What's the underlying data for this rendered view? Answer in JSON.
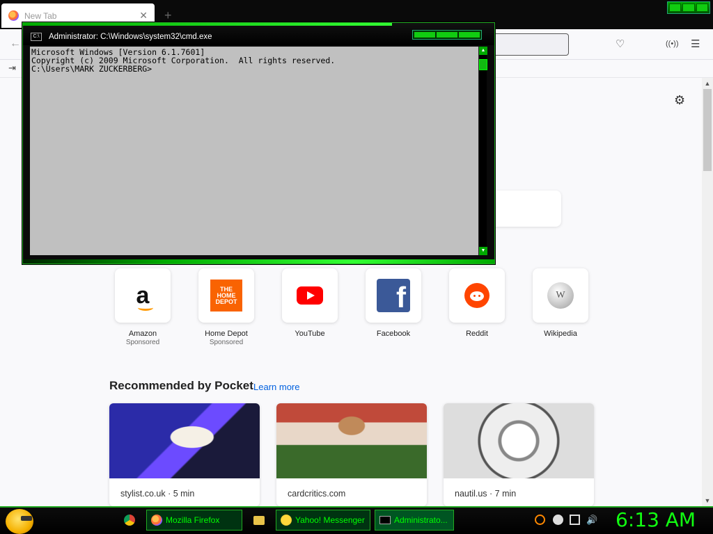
{
  "browser": {
    "tab_title": "New Tab",
    "tab_close": "✕",
    "new_tab": "+",
    "back": "←",
    "toolbar_icons": [
      "pocket-icon",
      "account-icon",
      "extensions-icon",
      "menu-icon"
    ],
    "bookmarks_icon": "sign-in-icon"
  },
  "newtab": {
    "settings_icon": "⚙",
    "top_sites": [
      {
        "name": "Amazon",
        "sponsored": "Sponsored",
        "logo": "a"
      },
      {
        "name": "Home Depot",
        "sponsored": "Sponsored",
        "logo": "THE HOME DEPOT"
      },
      {
        "name": "YouTube",
        "sponsored": ""
      },
      {
        "name": "Facebook",
        "sponsored": "",
        "logo": "f"
      },
      {
        "name": "Reddit",
        "sponsored": ""
      },
      {
        "name": "Wikipedia",
        "sponsored": "",
        "logo": "W"
      }
    ],
    "pocket_title": "Recommended by Pocket",
    "pocket_learn": "Learn more",
    "cards": [
      {
        "source": "stylist.co.uk · 5 min"
      },
      {
        "source": "cardcritics.com"
      },
      {
        "source": "nautil.us · 7 min"
      }
    ]
  },
  "cmd": {
    "title": "Administrator: C:\\Windows\\system32\\cmd.exe",
    "icon_text": "C:\\",
    "lines": [
      "Microsoft Windows [Version 6.1.7601]",
      "Copyright (c) 2009 Microsoft Corporation.  All rights reserved.",
      "",
      "C:\\Users\\MARK ZUCKERBERG>"
    ]
  },
  "taskbar": {
    "items": [
      {
        "label": "",
        "icon": "chrome-icon"
      },
      {
        "label": "Mozilla Firefox",
        "icon": "firefox-icon"
      },
      {
        "label": "",
        "icon": "folder-icon"
      },
      {
        "label": "Yahoo! Messenger",
        "icon": "yahoo-messenger-icon"
      },
      {
        "label": "Administrato...",
        "icon": "cmd-icon"
      }
    ],
    "clock": "6:13 AM"
  },
  "colors": {
    "accent_green": "#11ee11",
    "pocket_link": "#0060df"
  }
}
